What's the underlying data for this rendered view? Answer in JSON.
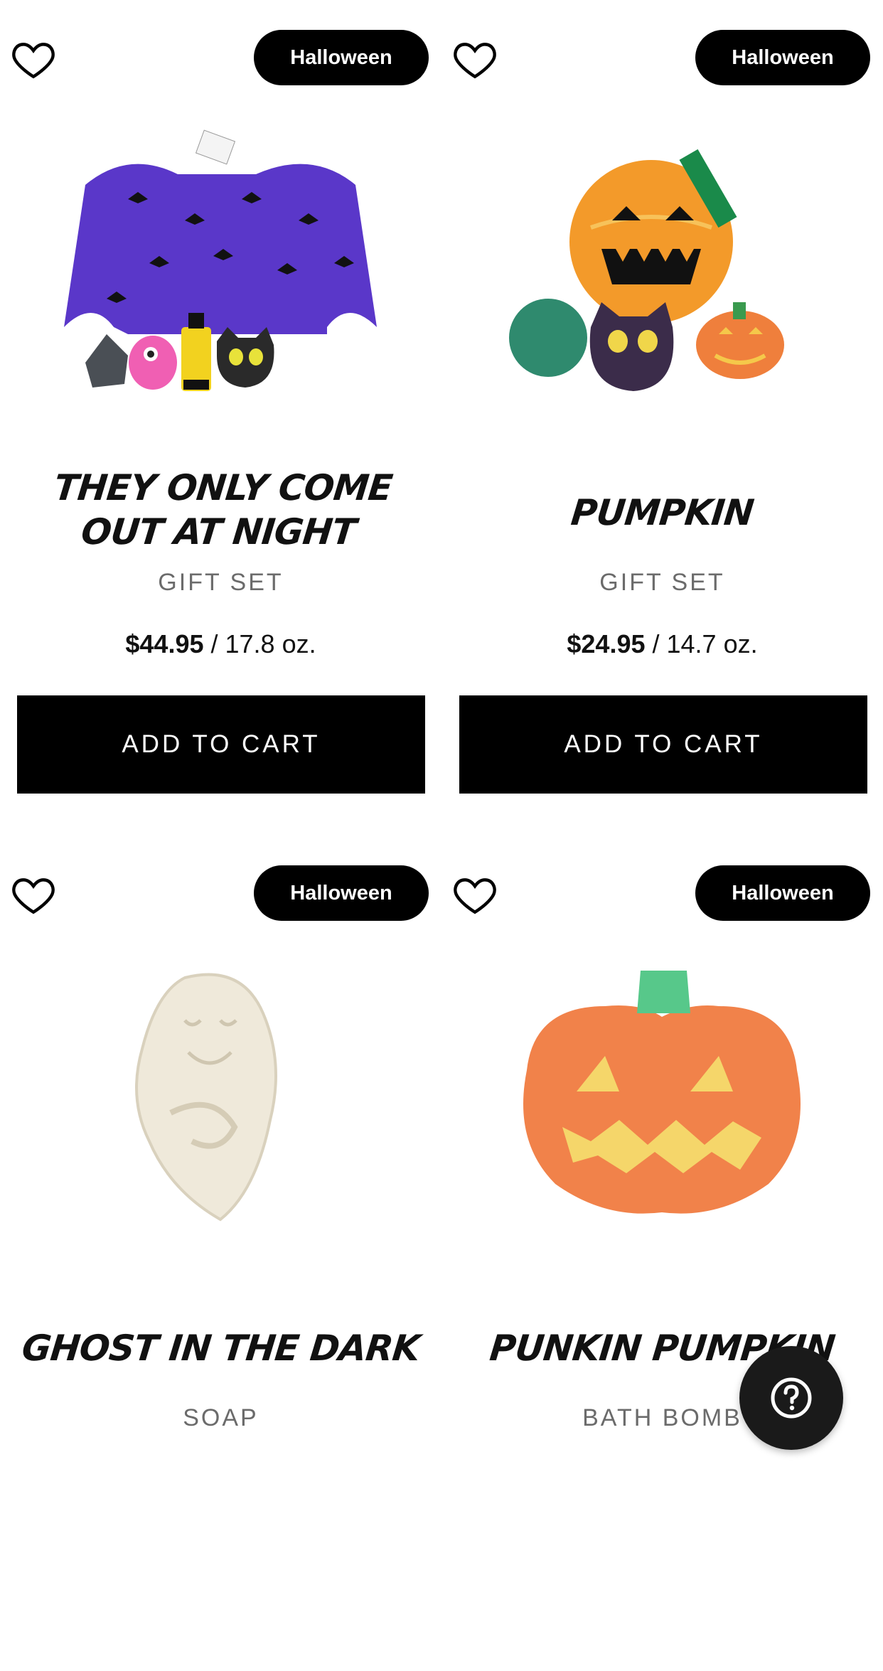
{
  "products": [
    {
      "badge": "Halloween",
      "title": "They Only Come Out At Night",
      "subtitle": "GIFT SET",
      "price": "$44.95",
      "size": "/ 17.8 oz.",
      "button": "ADD TO CART",
      "image_icon": "bat-gift-set-icon"
    },
    {
      "badge": "Halloween",
      "title": "Pumpkin",
      "subtitle": "GIFT SET",
      "price": "$24.95",
      "size": "/ 14.7 oz.",
      "button": "ADD TO CART",
      "image_icon": "pumpkin-gift-set-icon"
    },
    {
      "badge": "Halloween",
      "title": "Ghost In The Dark",
      "subtitle": "SOAP",
      "image_icon": "ghost-soap-icon"
    },
    {
      "badge": "Halloween",
      "title": "Punkin Pumpkin",
      "subtitle": "BATH BOMB",
      "image_icon": "pumpkin-bath-bomb-icon"
    }
  ],
  "help_button": {
    "icon": "question-mark-icon",
    "color": "#1a1a1a"
  },
  "colors": {
    "badge": "#000000",
    "button": "#000000",
    "subtitle": "#6b6b6b"
  }
}
